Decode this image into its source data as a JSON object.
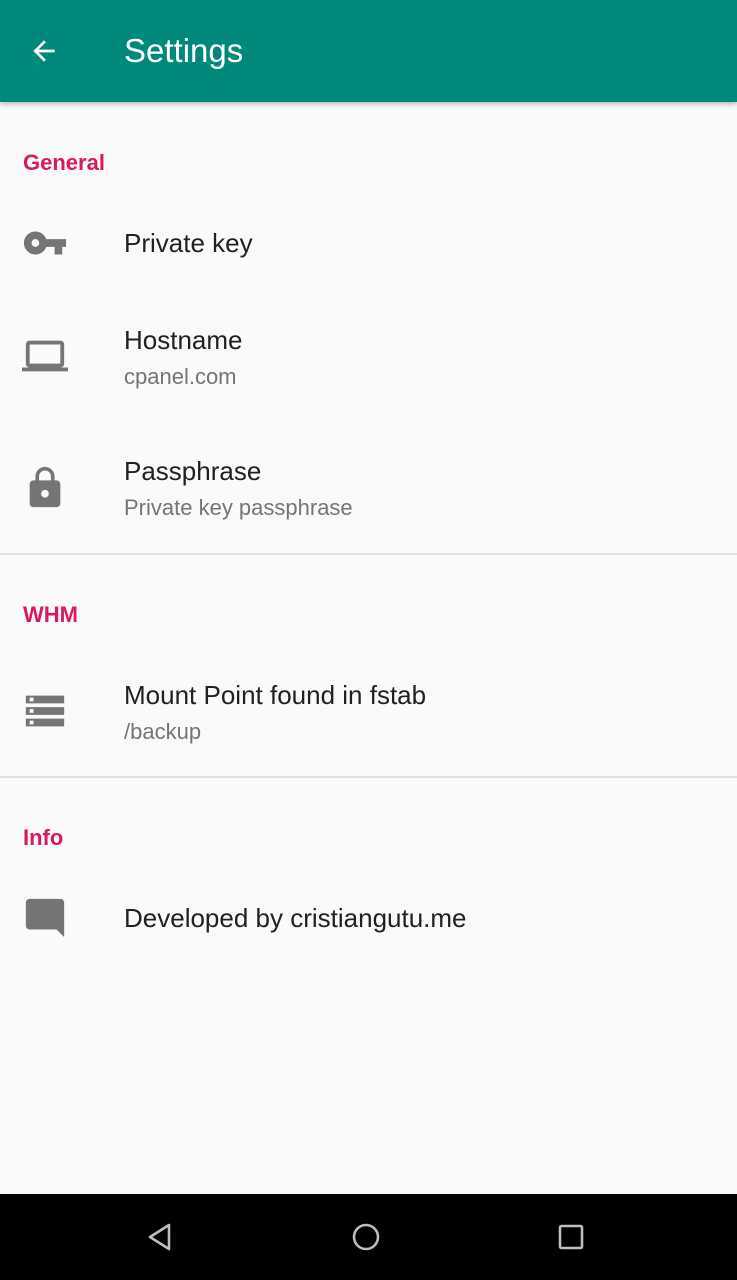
{
  "app_bar": {
    "title": "Settings",
    "background": "#00897b",
    "back_icon": "arrow-back-icon"
  },
  "accent_color": "#d81b60",
  "sections": [
    {
      "header": "General",
      "items": [
        {
          "icon": "key-icon",
          "title": "Private key",
          "summary": ""
        },
        {
          "icon": "laptop-icon",
          "title": "Hostname",
          "summary": "cpanel.com"
        },
        {
          "icon": "lock-icon",
          "title": "Passphrase",
          "summary": "Private key passphrase"
        }
      ]
    },
    {
      "header": "WHM",
      "items": [
        {
          "icon": "storage-icon",
          "title": "Mount Point found in fstab",
          "summary": "/backup"
        }
      ]
    },
    {
      "header": "Info",
      "items": [
        {
          "icon": "message-icon",
          "title": "Developed by cristiangutu.me",
          "summary": ""
        }
      ]
    }
  ],
  "nav_bar": {
    "buttons": [
      "back-triangle-icon",
      "home-circle-icon",
      "recents-square-icon"
    ]
  }
}
